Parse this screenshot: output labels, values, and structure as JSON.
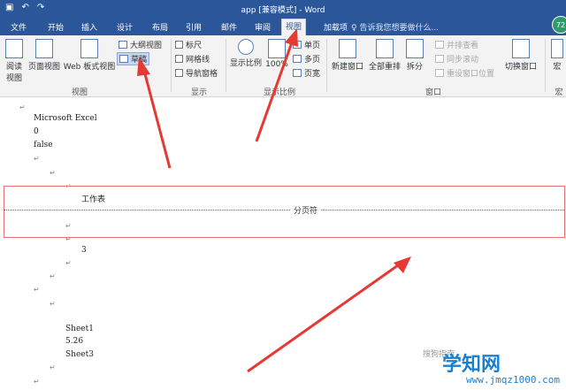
{
  "window": {
    "title": "app [兼容模式] - Word",
    "quick_access": [
      "▣",
      "↶",
      "↷"
    ],
    "avatar": "72"
  },
  "tabs": [
    {
      "label": "文件"
    },
    {
      "label": "开始"
    },
    {
      "label": "插入"
    },
    {
      "label": "设计"
    },
    {
      "label": "布局"
    },
    {
      "label": "引用"
    },
    {
      "label": "邮件"
    },
    {
      "label": "审阅"
    },
    {
      "label": "视图"
    },
    {
      "label": "加载项"
    }
  ],
  "tell_me": "♀ 告诉我您想要做什么...",
  "ribbon": {
    "views": {
      "read_mode": "阅读\n视图",
      "print_layout": "页面视图",
      "web_layout": "Web 板式视图",
      "outline": "大纲视图",
      "draft": "草稿",
      "label": "视图"
    },
    "show": {
      "ruler": "标尺",
      "gridlines": "网格线",
      "nav_pane": "导航窗格",
      "label": "显示"
    },
    "zoom": {
      "zoom": "显示比例",
      "hundred": "100%",
      "one_page": "单页",
      "multi_page": "多页",
      "page_width": "页宽",
      "label": "显示比例"
    },
    "window": {
      "new_window": "新建窗口",
      "arrange_all": "全部重排",
      "split": "拆分",
      "side_by_side": "并排查看",
      "sync_scroll": "同步滚动",
      "reset_position": "重设窗口位置",
      "switch_windows": "切换窗口",
      "label": "窗口"
    },
    "macros": {
      "macros": "宏",
      "label": "宏"
    }
  },
  "document": {
    "lines": [
      "Microsoft Excel",
      "0",
      "false",
      "工作表",
      "3",
      "Sheet1",
      "5.26",
      "Sheet3"
    ],
    "page_break": "分页符",
    "para_mark": "↵"
  },
  "watermark": {
    "text": "搜狗指南",
    "logo": "学知网",
    "logo_url": "www.jmqz1000.com"
  }
}
